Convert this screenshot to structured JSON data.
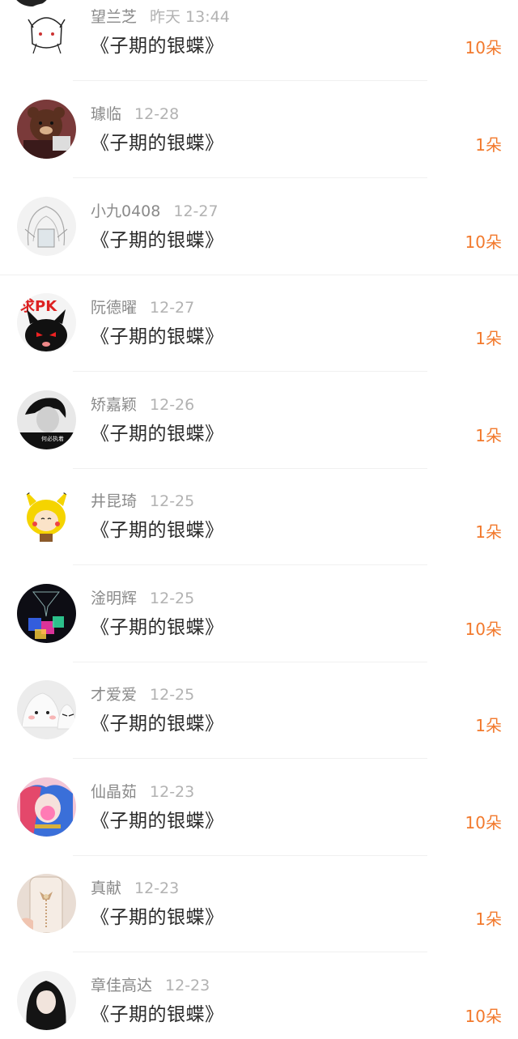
{
  "gifts": [
    {
      "name": "望兰芝",
      "time": "昨天 13:44",
      "title": "《子期的银蝶》",
      "amount": "10朵",
      "avatar": "anime-girl-avatar"
    },
    {
      "name": "璩临",
      "time": "12-28",
      "title": "《子期的银蝶》",
      "amount": "1朵",
      "avatar": "bear-doll-avatar"
    },
    {
      "name": "小九0408",
      "time": "12-27",
      "title": "《子期的银蝶》",
      "amount": "10朵",
      "avatar": "sketch-girl-avatar"
    },
    {
      "name": "阮德曜",
      "time": "12-27",
      "title": "《子期的银蝶》",
      "amount": "1朵",
      "avatar": "black-cat-avatar"
    },
    {
      "name": "矫嘉颖",
      "time": "12-26",
      "title": "《子期的银蝶》",
      "amount": "1朵",
      "avatar": "portrait-bw-avatar"
    },
    {
      "name": "井昆琦",
      "time": "12-25",
      "title": "《子期的银蝶》",
      "amount": "1朵",
      "avatar": "pikachu-girl-avatar"
    },
    {
      "name": "淦明辉",
      "time": "12-25",
      "title": "《子期的银蝶》",
      "amount": "10朵",
      "avatar": "ice-cubes-avatar"
    },
    {
      "name": "才爱爱",
      "time": "12-25",
      "title": "《子期的银蝶》",
      "amount": "1朵",
      "avatar": "rice-balls-avatar"
    },
    {
      "name": "仙晶茹",
      "time": "12-23",
      "title": "《子期的银蝶》",
      "amount": "10朵",
      "avatar": "bubblegum-girl-avatar"
    },
    {
      "name": "真献",
      "time": "12-23",
      "title": "《子期的银蝶》",
      "amount": "1朵",
      "avatar": "phone-case-avatar"
    },
    {
      "name": "章佳高达",
      "time": "12-23",
      "title": "《子期的银蝶》",
      "amount": "10朵",
      "avatar": "long-hair-girl-avatar"
    }
  ],
  "colors": {
    "accent": "#f2792c",
    "name": "#8a8a8a",
    "time": "#b2b2b2",
    "title": "#2a2a2a"
  }
}
